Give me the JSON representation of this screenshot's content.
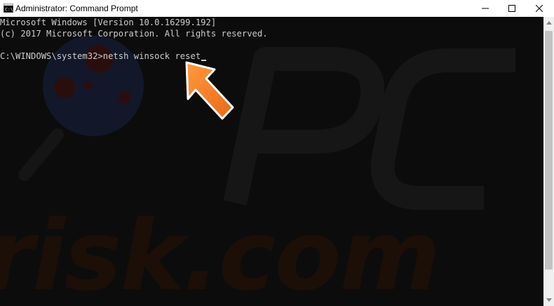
{
  "window": {
    "title": "Administrator: Command Prompt",
    "icon": "cmd-icon"
  },
  "controls": {
    "minimize": "minimize-icon",
    "maximize": "maximize-icon",
    "close": "close-icon"
  },
  "console": {
    "lines": [
      "Microsoft Windows [Version 10.0.16299.192]",
      "(c) 2017 Microsoft Corporation. All rights reserved.",
      ""
    ],
    "prompt": "C:\\WINDOWS\\system32>",
    "command": "netsh winsock reset"
  },
  "watermark": {
    "text": "risk.com"
  },
  "colors": {
    "console_bg": "#0c0c0c",
    "console_text": "#cccccc",
    "arrow": "#f47b20",
    "titlebar_bg": "#ffffff"
  }
}
